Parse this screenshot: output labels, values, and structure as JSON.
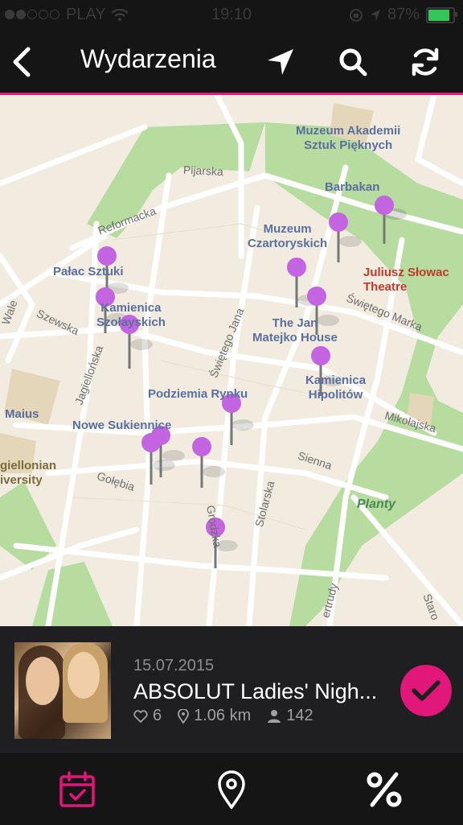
{
  "status_bar": {
    "carrier": "PLAY",
    "time": "19:10",
    "battery": "87%"
  },
  "nav": {
    "title": "Wydarzenia"
  },
  "map": {
    "labels": {
      "muzeum_akademii": "Muzeum Akademii\nSztuk Pięknych",
      "barbakan": "Barbakan",
      "muzeum_czartoryskich": "Muzeum\nCzartoryskich",
      "juliusz": "Juliusz Słowac\nTheatre",
      "palac_sztuki": "Pałac Sztuki",
      "kamienica_szolayskich": "Kamienica\nSzołayskich",
      "jan_matejko": "The Jan\nMatejko House",
      "kamienica_hipolitow": "Kamienica\nHipolitów",
      "podziemia": "Podziemia Rynku",
      "nowe_sukiennice": "Nowe Sukiennice",
      "maius": "Maius",
      "jagiellonian": "giellonian\niversity",
      "planty": "Planty"
    },
    "streets": {
      "pijarska": "Pijarska",
      "reformacka": "Reformacka",
      "szewska": "Szewska",
      "jagiellonska": "Jagiellońska",
      "swietego_jana": "Świętego Jana",
      "swietego_marka": "Świętego Marka",
      "mikolajska": "Mikołajska",
      "sienna": "Sienna",
      "golebia": "Gołębia",
      "stolarska": "Stolarska",
      "grodzka": "Grodzka",
      "wale": "Wale",
      "trudy": "ertrudy",
      "staro": "Staro"
    }
  },
  "event": {
    "date": "15.07.2015",
    "title": "ABSOLUT Ladies' Nigh...",
    "likes": "6",
    "distance": "1.06 km",
    "attendees": "142"
  },
  "colors": {
    "accent": "#e2177a",
    "pin": "#c364e0",
    "park": "#b6dca0"
  }
}
